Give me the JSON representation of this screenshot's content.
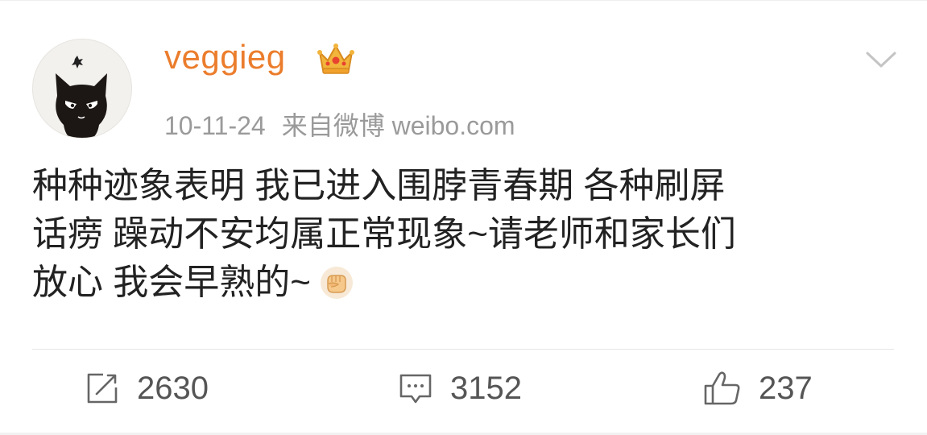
{
  "post": {
    "username": "veggieg",
    "badge_icon": "crown-icon",
    "date": "10-11-24",
    "source": "来自微博 weibo.com",
    "content_lines": [
      "种种迹象表明 我已进入围脖青春期 各种刷屏",
      "话痨 躁动不安均属正常现象~请老师和家长们",
      "放心 我会早熟的~"
    ],
    "content_emoji": "fist-emoji-icon",
    "menu_icon": "chevron-down-icon"
  },
  "actions": {
    "repost_count": "2630",
    "comment_count": "3152",
    "like_count": "237"
  },
  "colors": {
    "username": "#eb7d2c",
    "meta_text": "#9a9a9a",
    "body_text": "#222222",
    "action_text": "#555555"
  }
}
